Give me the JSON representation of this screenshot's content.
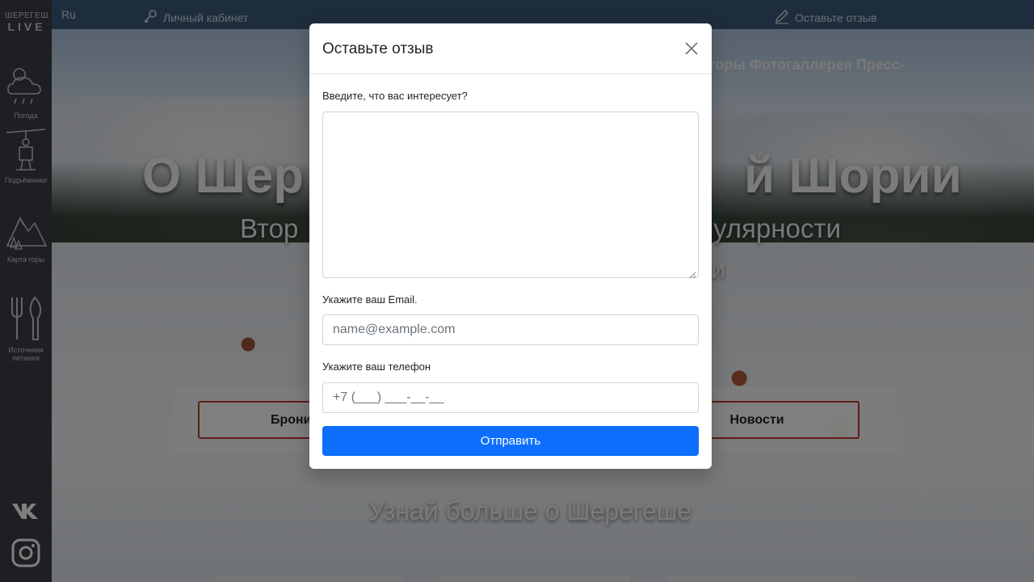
{
  "topbar": {
    "language": "Ru",
    "cabinet_label": "Личный кабинет",
    "review_label": "Оставьте отзыв"
  },
  "sidebar": {
    "logo_line1": "ШЕРЕГЕШ",
    "logo_line2": "LIVE",
    "items": [
      {
        "label": "Погода",
        "icon": "weather-icon"
      },
      {
        "label": "Подъёмники",
        "icon": "ski-lift-icon"
      },
      {
        "label": "Карта горы",
        "icon": "mountain-map-icon"
      },
      {
        "label": "Источники питания",
        "icon": "food-icon"
      }
    ],
    "social": [
      {
        "icon": "vk-icon"
      },
      {
        "icon": "instagram-icon"
      }
    ]
  },
  "hero": {
    "nav_visible": "и горы  Фотогаллерея  Пресс-",
    "title_left": "О Шер",
    "title_right": "й Шории",
    "subtitle_left": "Втор",
    "subtitle_right": "улярности",
    "subtitle_line2": "и",
    "booking_label": "Брониро",
    "news_label": "Новости",
    "learn_more": "Узнай больше о Шерегеше"
  },
  "modal": {
    "title": "Оставьте отзыв",
    "message_label": "Введите, что вас интересует?",
    "email_label": "Укажите ваш Email.",
    "email_placeholder": "name@example.com",
    "phone_label": "Укажите ваш телефон",
    "phone_placeholder": "+7 (___) ___-__-__",
    "submit_label": "Отправить"
  },
  "colors": {
    "primary": "#0d6efd",
    "topbar": "#3d5a7a",
    "sidebar": "#3a3f46",
    "accent_border": "#c0392b"
  }
}
